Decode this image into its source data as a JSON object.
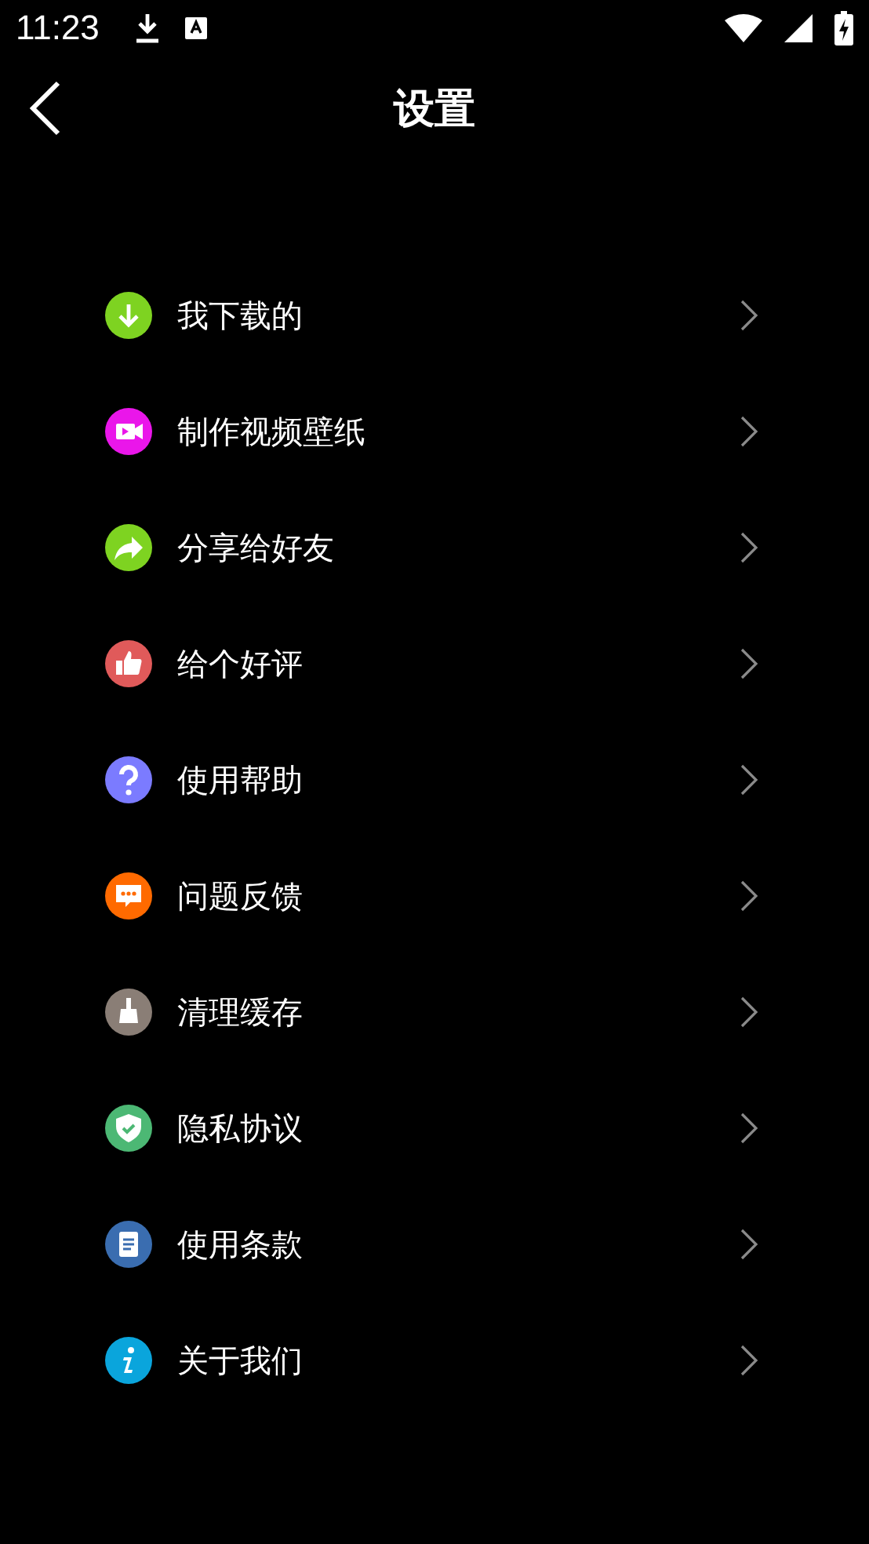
{
  "status_bar": {
    "time": "11:23"
  },
  "header": {
    "title": "设置"
  },
  "items": [
    {
      "label": "我下载的",
      "kind": "download",
      "color": "#7ed321"
    },
    {
      "label": "制作视频壁纸",
      "kind": "video",
      "color": "#ea16ea"
    },
    {
      "label": "分享给好友",
      "kind": "share",
      "color": "#7ed321"
    },
    {
      "label": "给个好评",
      "kind": "thumb",
      "color": "#e05a5a"
    },
    {
      "label": "使用帮助",
      "kind": "question",
      "color": "#7b7bff"
    },
    {
      "label": "问题反馈",
      "kind": "chat",
      "color": "#ff6a00"
    },
    {
      "label": "清理缓存",
      "kind": "broom",
      "color": "#8a7e76"
    },
    {
      "label": "隐私协议",
      "kind": "shield",
      "color": "#4cb874"
    },
    {
      "label": "使用条款",
      "kind": "document",
      "color": "#3a6db0"
    },
    {
      "label": "关于我们",
      "kind": "info",
      "color": "#0aa5dc"
    }
  ]
}
